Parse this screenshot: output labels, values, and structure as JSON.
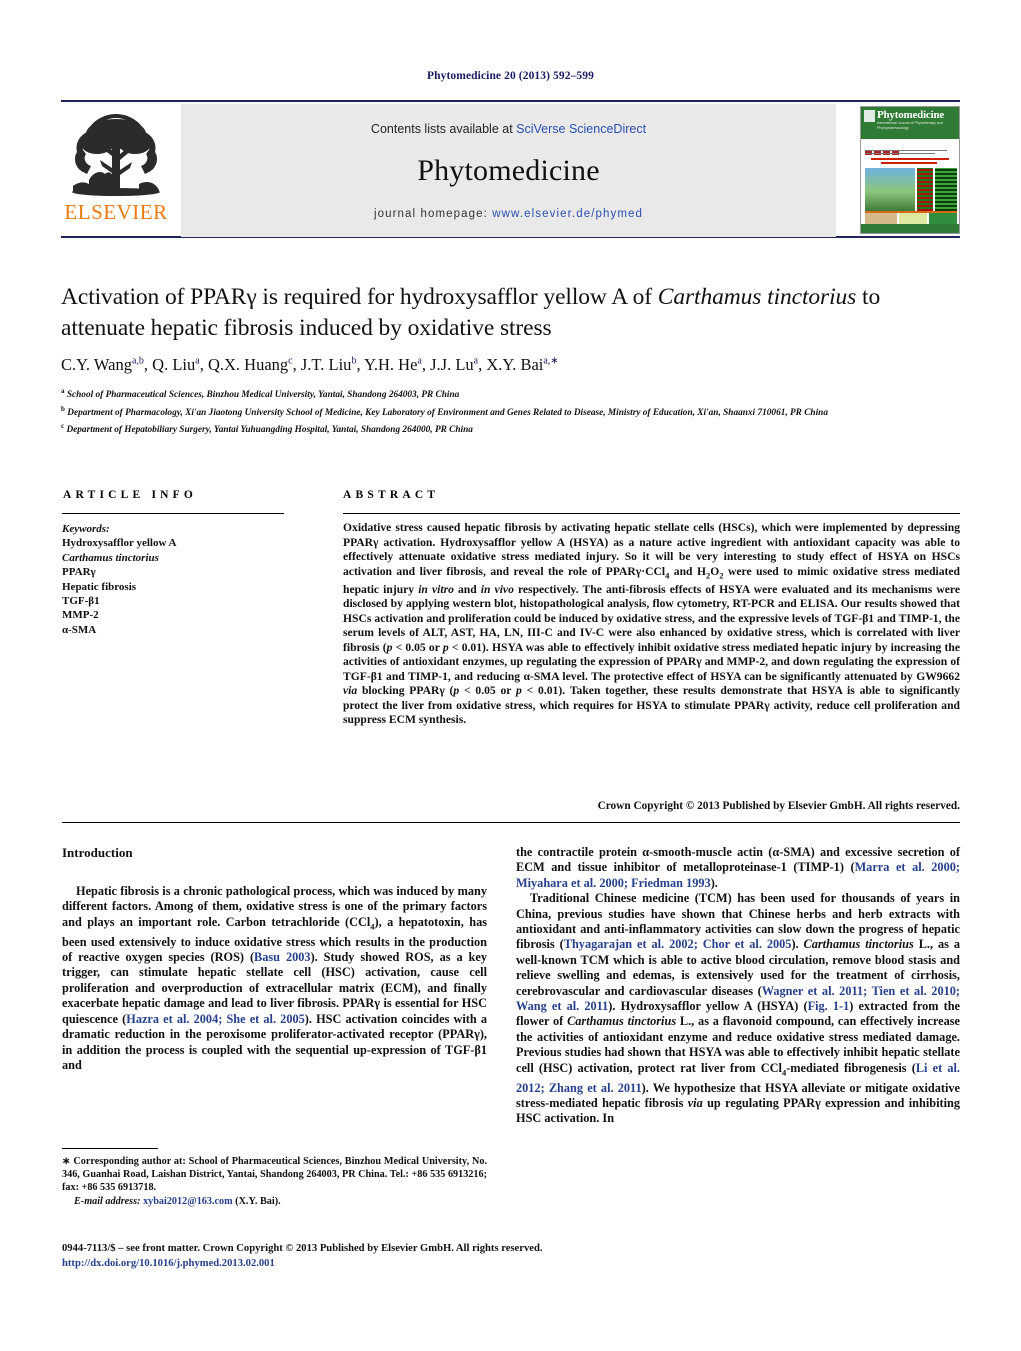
{
  "running_head": "Phytomedicine 20 (2013) 592–599",
  "masthead": {
    "publisher_logo_name": "ELSEVIER",
    "contents_prefix": "Contents lists available at ",
    "contents_link": "SciVerse ScienceDirect",
    "journal_title": "Phytomedicine",
    "homepage_label": "journal homepage: ",
    "homepage_url": "www.elsevier.de/phymed",
    "cover": {
      "title": "Phytomedicine",
      "subtitle": "International Journal of Phytotherapy and Phytopharmacology"
    },
    "rule_color": "#23235e",
    "link_color": "#2b4fb0",
    "banner_bg": "#e9e9e9"
  },
  "title": {
    "line1_a": "Activation of PPAR",
    "line1_gamma": "γ",
    "line1_b": " is required for hydroxysafflor yellow A of ",
    "line1_italic": "Carthamus",
    "line2_italic": "tinctorius",
    "line2_b": " to attenuate hepatic fibrosis induced by oxidative stress"
  },
  "authors": [
    {
      "name": "C.Y. Wang",
      "sup": "a,b"
    },
    {
      "name": "Q. Liu",
      "sup": "a"
    },
    {
      "name": "Q.X. Huang",
      "sup": "c"
    },
    {
      "name": "J.T. Liu",
      "sup": "b"
    },
    {
      "name": "Y.H. He",
      "sup": "a"
    },
    {
      "name": "J.J. Lu",
      "sup": "a"
    },
    {
      "name": "X.Y. Bai",
      "sup": "a,∗"
    }
  ],
  "affiliations": [
    {
      "mark": "a",
      "text": "School of Pharmaceutical Sciences, Binzhou Medical University, Yantai, Shandong 264003, PR China"
    },
    {
      "mark": "b",
      "text": "Department of Pharmacology, Xi'an Jiaotong University School of Medicine, Key Laboratory of Environment and Genes Related to Disease, Ministry of Education, Xi'an, Shaanxi 710061, PR China"
    },
    {
      "mark": "c",
      "text": "Department of Hepatobiliary Surgery, Yantai Yuhuangding Hospital, Yantai, Shandong 264000, PR China"
    }
  ],
  "article_info": {
    "heading": "ARTICLE INFO",
    "keywords_label": "Keywords:",
    "keywords": [
      "Hydroxysafflor yellow A",
      "Carthamus tinctorius",
      "PPARγ",
      "Hepatic fibrosis",
      "TGF-β1",
      "MMP-2",
      "α-SMA"
    ]
  },
  "abstract": {
    "heading": "ABSTRACT",
    "text_part1": "Oxidative stress caused hepatic fibrosis by activating hepatic stellate cells (HSCs), which were implemented by depressing PPARγ activation. Hydroxysafflor yellow A (HSYA) as a nature active ingredient with antioxidant capacity was able to effectively attenuate oxidative stress mediated injury. So it will be very interesting to study effect of HSYA on HSCs activation and liver fibrosis, and reveal the role of PPARγ·CCl",
    "sub1": "4",
    "text_part2": " and H",
    "sub2": "2",
    "text_part3": "O",
    "sub3": "2",
    "text_part4": " were used to mimic oxidative stress mediated hepatic injury ",
    "italic1": "in vitro",
    "text_part5": " and ",
    "italic2": "in vivo",
    "text_part6": " respectively. The anti-fibrosis effects of HSYA were evaluated and its mechanisms were disclosed by applying western blot, histopathological analysis, flow cytometry, RT-PCR and ELISA. Our results showed that HSCs activation and proliferation could be induced by oxidative stress, and the expressive levels of TGF-β1 and TIMP-1, the serum levels of ALT, AST, HA, LN, III-C and IV-C were also enhanced by oxidative stress, which is correlated with liver fibrosis (",
    "italic3": "p",
    "text_part7": " < 0.05 or ",
    "italic4": "p",
    "text_part8": " < 0.01). HSYA was able to effectively inhibit oxidative stress mediated hepatic injury by increasing the activities of antioxidant enzymes, up regulating the expression of PPARγ and MMP-2, and down regulating the expression of TGF-β1 and TIMP-1, and reducing α-SMA level. The protective effect of HSYA can be significantly attenuated by GW9662 ",
    "italic5": "via",
    "text_part9": " blocking PPARγ (",
    "italic6": "p",
    "text_part10": " < 0.05 or ",
    "italic7": "p",
    "text_part11": " < 0.01). Taken together, these results demonstrate that HSYA is able to significantly protect the liver from oxidative stress, which requires for HSYA to stimulate PPARγ activity, reduce cell proliferation and suppress ECM synthesis.",
    "copyright": "Crown Copyright © 2013 Published by Elsevier GmbH. All rights reserved."
  },
  "body": {
    "section_heading": "Introduction",
    "left_p1_a": "Hepatic fibrosis is a chronic pathological process, which was induced by many different factors. Among of them, oxidative stress is one of the primary factors and plays an important role. Carbon tetrachloride (CCl",
    "left_p1_sub": "4",
    "left_p1_b": "), a hepatotoxin, has been used extensively to induce oxidative stress which results in the production of reactive oxygen species (ROS) (",
    "left_ref1": "Basu 2003",
    "left_p1_c": "). Study showed ROS, as a key trigger, can stimulate hepatic stellate cell (HSC) activation, cause cell proliferation and overproduction of extracellular matrix (ECM), and finally exacerbate hepatic damage and lead to liver fibrosis. PPARγ is essential for HSC quiescence (",
    "left_ref2": "Hazra et al. 2004; She et al. 2005",
    "left_p1_d": "). HSC activation coincides with a dramatic reduction in the peroxisome proliferator-activated receptor (PPARγ), in addition the process is coupled with the sequential up-expression of TGF-β1 and",
    "right_p1_a": "the contractile protein α-smooth-muscle actin (α-SMA) and excessive secretion of ECM and tissue inhibitor of metalloproteinase-1 (TIMP-1) (",
    "right_ref1": "Marra et al. 2000; Miyahara et al. 2000; Friedman 1993",
    "right_p1_b": ").",
    "right_p2_a": "Traditional Chinese medicine (TCM) has been used for thousands of years in China, previous studies have shown that Chinese herbs and herb extracts with antioxidant and anti-inflammatory activities can slow down the progress of hepatic fibrosis (",
    "right_ref2": "Thyagarajan et al. 2002; Chor et al. 2005",
    "right_p2_b": "). ",
    "right_italic1": "Carthamus tinctorius",
    "right_p2_c": " L., as a well-known TCM which is able to active blood circulation, remove blood stasis and relieve swelling and edemas, is extensively used for the treatment of cirrhosis, cerebrovascular and cardiovascular diseases (",
    "right_ref3": "Wagner et al. 2011; Tien et al. 2010; Wang et al. 2011",
    "right_p2_d": "). Hydroxysafflor yellow A (HSYA) (",
    "right_ref4": "Fig. 1-1",
    "right_p2_e": ") extracted from the flower of ",
    "right_italic2": "Carthamus tinctorius",
    "right_p2_f": " L., as a flavonoid compound, can effectively increase the activities of antioxidant enzyme and reduce oxidative stress mediated damage. Previous studies had shown that HSYA was able to effectively inhibit hepatic stellate cell (HSC) activation, protect rat liver from CCl",
    "right_p2_sub": "4",
    "right_p2_g": "-mediated fibrogenesis (",
    "right_ref5": "Li et al. 2012; Zhang et al. 2011",
    "right_p2_h": "). We hypothesize that HSYA alleviate or mitigate oxidative stress-mediated hepatic fibrosis ",
    "right_italic3": "via",
    "right_p2_i": " up regulating PPARγ expression and inhibiting HSC activation. In"
  },
  "footnote": {
    "star": "∗",
    "text": " Corresponding author at: School of Pharmaceutical Sciences, Binzhou Medical University, No. 346, Guanhai Road, Laishan District, Yantai, Shandong 264003, PR China. Tel.: +86 535 6913216; fax: +86 535 6913718.",
    "email_label": "E-mail address:",
    "email": "xybai2012@163.com",
    "email_suffix": " (X.Y. Bai)."
  },
  "footer": {
    "issn": "0944-7113/$ – see front matter. Crown Copyright © 2013 Published by Elsevier GmbH. All rights reserved.",
    "doi": "http://dx.doi.org/10.1016/j.phymed.2013.02.001"
  },
  "colors": {
    "link": "#27408b",
    "rule": "#23235e",
    "elsevier_orange": "#e87b10",
    "cover_green": "#2f7a35"
  }
}
